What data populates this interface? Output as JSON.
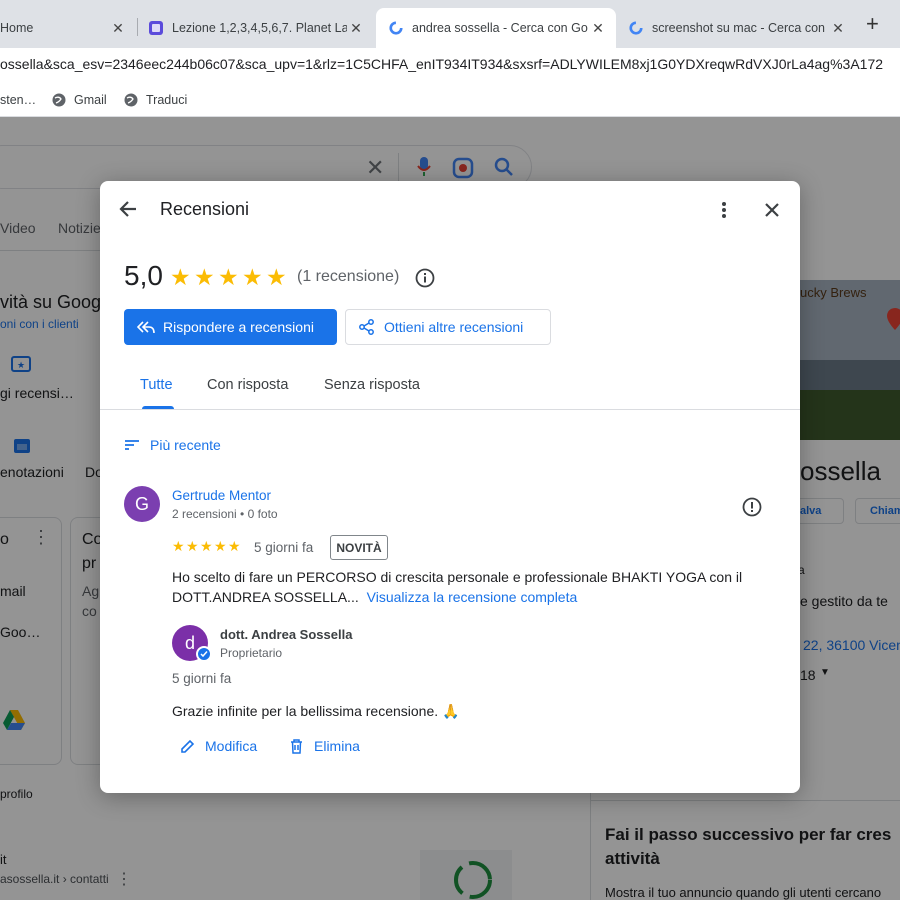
{
  "browser": {
    "tabs": [
      {
        "title": "Home",
        "active": false
      },
      {
        "title": "Lezione 1,2,3,4,5,6,7. Planet La",
        "active": false
      },
      {
        "title": "andrea sossella - Cerca con Go",
        "active": true
      },
      {
        "title": "screenshot su mac - Cerca con",
        "active": false
      }
    ],
    "new_tab_label": "+",
    "close_glyph": "✕",
    "url": "ossella&sca_esv=2346eec244b06c07&sca_upv=1&rlz=1C5CHFA_enIT934IT934&sxsrf=ADLYWILEM8xj1G0YDXreqwRdVXJ0rLa4ag%3A172",
    "bookmarks": [
      "sten…",
      "Gmail",
      "Traduci"
    ]
  },
  "background": {
    "nav_video": "Video",
    "nav_news": "Notizie",
    "activity_title": "vità su Google",
    "activity_sub": "oni con i clienti",
    "reviews_short": "gi recensi…",
    "bookings_short": "enotazioni",
    "do_short": "Do",
    "email_short": "mail",
    "goo_short": "Goo…",
    "co_short": "Co",
    "pr_short": "pr",
    "ag_short": "Ag",
    "co2_short": "co",
    "profile_short": "profilo",
    "it_short": "it",
    "site_short": "asossella.it › contatti",
    "brand_sign": "ucky Brews",
    "biz_name": "ossella",
    "save_btn": "alva",
    "call_btn": "Chiam",
    "managed": "e gestito da te",
    "address": "22, 36100 Vicen",
    "hours": "18",
    "next_step_title": "Fai il passo successivo per far cres attività",
    "next_step_sub": "Mostra il tuo annuncio quando gli utenti cercano"
  },
  "dialog": {
    "title": "Recensioni",
    "rating": "5,0",
    "stars": 5,
    "count_label": "(1 recensione)",
    "reply_button": "Rispondere a recensioni",
    "get_more_button": "Ottieni altre recensioni",
    "tabs": [
      "Tutte",
      "Con risposta",
      "Senza risposta"
    ],
    "sort_label": "Più recente",
    "review": {
      "avatar_letter": "G",
      "author": "Gertrude Mentor",
      "author_meta": "2 recensioni • 0 foto",
      "rating": 5,
      "time": "5 giorni fa",
      "badge": "NOVITÀ",
      "text": "Ho scelto di fare un PERCORSO di crescita personale e professionale BHAKTI YOGA con il DOTT.ANDREA SOSSELLA...",
      "read_more": "Visualizza la recensione completa"
    },
    "reply": {
      "avatar_letter": "d",
      "owner": "dott. Andrea Sossella",
      "role": "Proprietario",
      "time": "5 giorni fa",
      "text": "Grazie infinite per la bellissima recensione. 🙏",
      "edit": "Modifica",
      "delete": "Elimina"
    }
  },
  "colors": {
    "accent": "#1a73e8",
    "star": "#fbbc04",
    "reviewer_avatar": "#7b3fb0",
    "owner_avatar": "#7b2fa8"
  }
}
